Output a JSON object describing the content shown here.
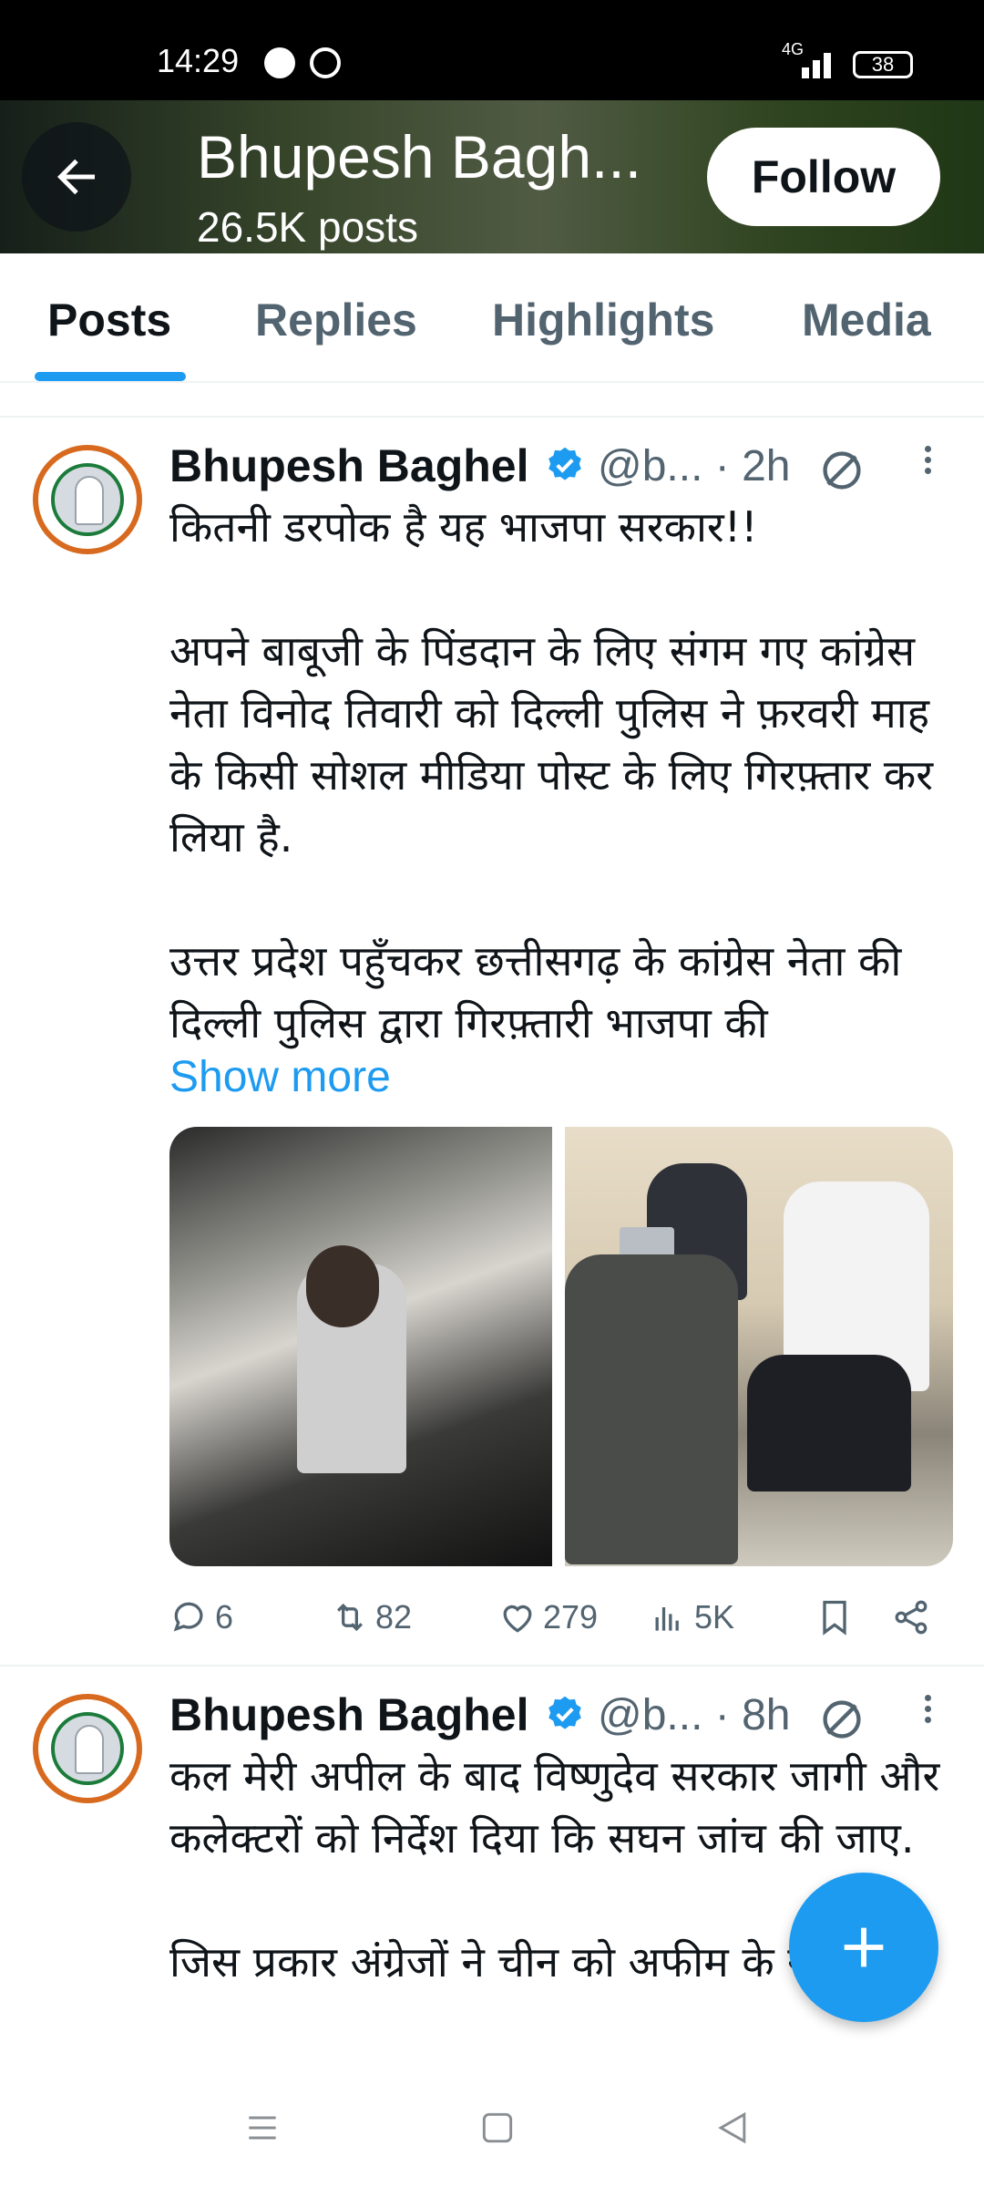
{
  "status_bar": {
    "time": "14:29",
    "network": "4G",
    "battery": "38",
    "icons": [
      "messenger-icon",
      "whatsapp-icon",
      "signal-icon",
      "battery-icon"
    ]
  },
  "header": {
    "name": "Bhupesh Bagh...",
    "post_count": "26.5K posts",
    "follow_label": "Follow"
  },
  "tabs": [
    {
      "label": "Posts",
      "active": true
    },
    {
      "label": "Replies",
      "active": false
    },
    {
      "label": "Highlights",
      "active": false
    },
    {
      "label": "Media",
      "active": false
    }
  ],
  "posts": [
    {
      "author": "Bhupesh Baghel",
      "handle": "@b...",
      "time": "· 2h",
      "text": "कितनी डरपोक है यह भाजपा सरकार!!\n\nअपने बाबूजी के पिंडदान के लिए संगम गए कांग्रेस नेता विनोद तिवारी को दिल्ली पुलिस ने फ़रवरी माह के किसी सोशल मीडिया पोस्ट के लिए गिरफ़्तार कर लिया है.\n\nउत्तर प्रदेश पहुँचकर छत्तीसगढ़ के कांग्रेस नेता की दिल्ली पुलिस द्वारा गिरफ़्तारी भाजपा की",
      "show_more": "Show more",
      "stats": {
        "replies": "6",
        "reposts": "82",
        "likes": "279",
        "views": "5K"
      }
    },
    {
      "author": "Bhupesh Baghel",
      "handle": "@b...",
      "time": "· 8h",
      "text": "कल मेरी अपील के बाद विष्णुदेव सरकार जागी और कलेक्टरों को निर्देश दिया कि सघन जांच की जाए.\n\nजिस प्रकार अंग्रेजों ने चीन को अफीम के नशे में"
    }
  ],
  "colors": {
    "accent": "#1d9bf0",
    "text": "#0f1419",
    "secondary": "#536471"
  }
}
